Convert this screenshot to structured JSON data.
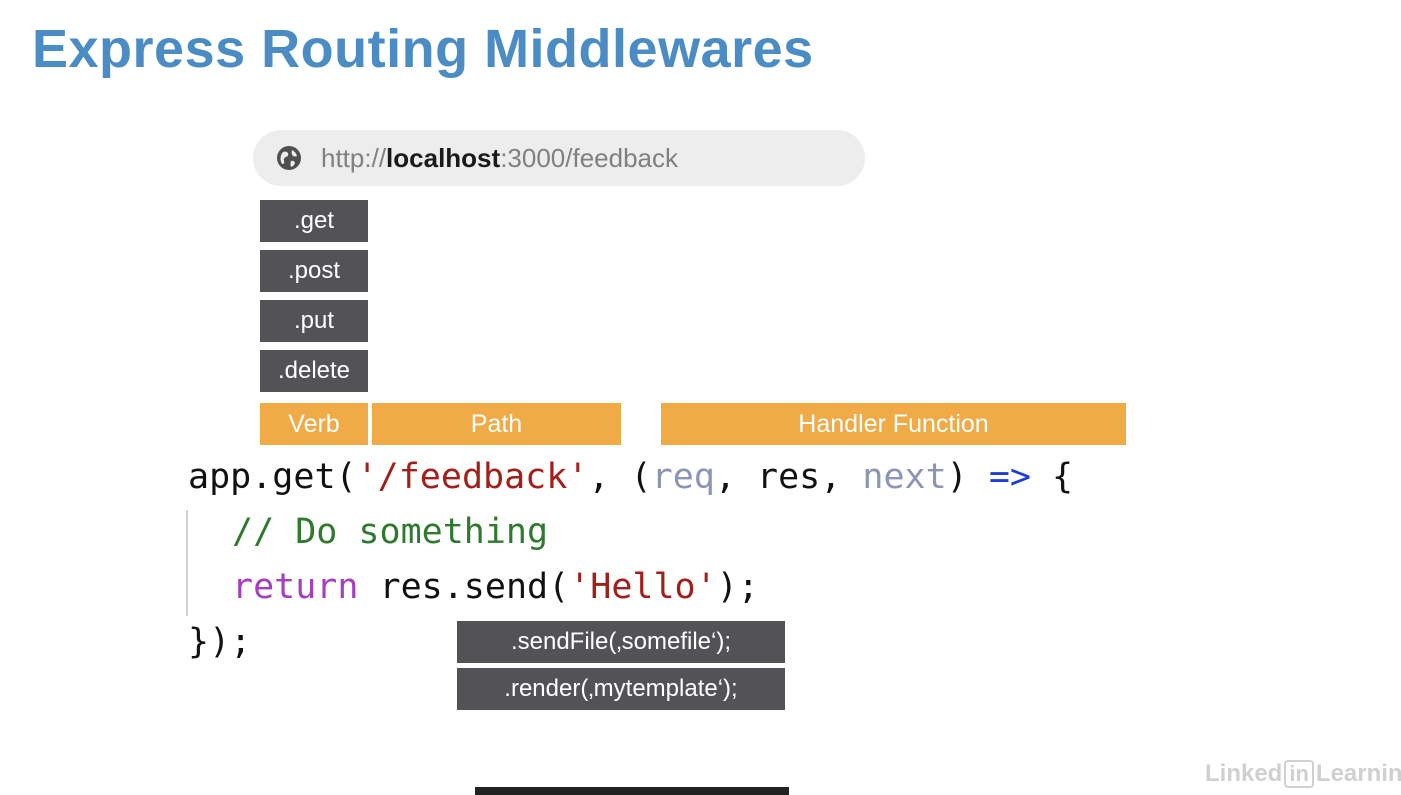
{
  "slide": {
    "title": "Express Routing Middlewares"
  },
  "url_bar": {
    "icon": "globe-icon",
    "protocol": "http://",
    "host": "localhost",
    "rest": ":3000/feedback"
  },
  "verbs": [
    ".get",
    ".post",
    ".put",
    ".delete"
  ],
  "labels": {
    "verb": "Verb",
    "path": "Path",
    "handler": "Handler Function",
    "color": "#f0aa46"
  },
  "code": {
    "line1": {
      "obj": "app",
      "dot": ".",
      "method": "get",
      "open": "(",
      "path": "'/feedback'",
      "comma1": ", ",
      "paren": "(",
      "req": "req",
      "sep1": ", ",
      "res": "res",
      "sep2": ", ",
      "next": "next",
      "close": ") ",
      "arrow": "=>",
      "brace": " {"
    },
    "line2": "// Do something",
    "line3": {
      "kw": "return",
      "space": " ",
      "call": "res.send(",
      "arg": "'Hello'",
      "end": ");"
    },
    "line4": "});"
  },
  "response_methods": [
    ".sendFile(‚somefile‘);",
    ".render(‚mytemplate‘);"
  ],
  "watermark": {
    "prefix": "Linked",
    "in": "in",
    "suffix": "Learning"
  }
}
